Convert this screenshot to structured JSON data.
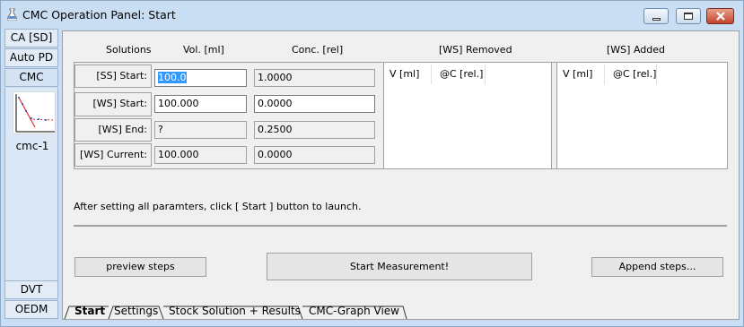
{
  "window": {
    "title": "CMC Operation Panel: Start",
    "controls": [
      "minimize-icon",
      "maximize-icon",
      "close-icon"
    ]
  },
  "sidebar": {
    "top_items": [
      {
        "label": "CA [SD]"
      },
      {
        "label": "Auto PD"
      },
      {
        "label": "CMC"
      }
    ],
    "thumbnail_label": "cmc-1",
    "bottom_items": [
      {
        "label": "DVT"
      },
      {
        "label": "OEDM"
      }
    ]
  },
  "headers": {
    "solutions": "Solutions",
    "volume": "Vol. [ml]",
    "concentration": "Conc. [rel]",
    "ws_removed": "[WS] Removed",
    "ws_added": "[WS] Added"
  },
  "rows": [
    {
      "label": "[SS] Start:",
      "vol": "100.0",
      "conc": "1.0000"
    },
    {
      "label": "[WS] Start:",
      "vol": "100.000",
      "conc": "0.0000"
    },
    {
      "label": "[WS] End:",
      "vol": "?",
      "conc": "0.2500"
    },
    {
      "label": "[WS] Current:",
      "vol": "100.000",
      "conc": "0.0000"
    }
  ],
  "removed_list": {
    "columns": [
      "V [ml]",
      "@C [rel.]"
    ]
  },
  "added_list": {
    "columns": [
      "V [ml]",
      "@C [rel.]"
    ]
  },
  "hint": "After setting all paramters, click [ Start ] button to launch.",
  "buttons": {
    "preview": "preview steps",
    "start": "Start Measurement!",
    "append": "Append steps..."
  },
  "tabs": [
    {
      "label": "Start",
      "active": true
    },
    {
      "label": "Settings"
    },
    {
      "label": "Stock Solution + Results"
    },
    {
      "label": "CMC-Graph View"
    }
  ]
}
